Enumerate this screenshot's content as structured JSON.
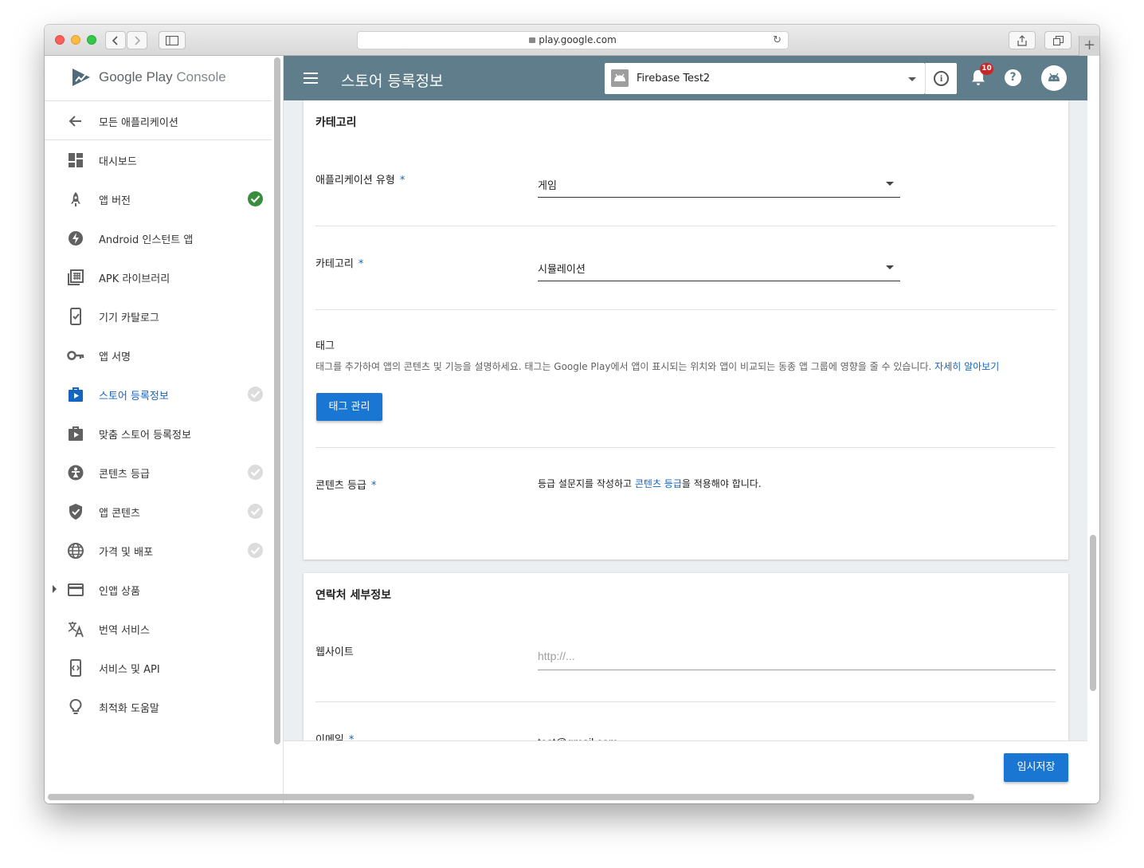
{
  "browser": {
    "url": "play.google.com"
  },
  "sidebar": {
    "brand_google": "Google Play",
    "brand_console": "Console",
    "back_label": "모든 애플리케이션",
    "items": [
      {
        "label": "대시보드",
        "icon": "dashboard-icon",
        "status": "none"
      },
      {
        "label": "앱 버전",
        "icon": "rocket-icon",
        "status": "complete"
      },
      {
        "label": "Android 인스턴트 앱",
        "icon": "instant-app-icon",
        "status": "none"
      },
      {
        "label": "APK 라이브러리",
        "icon": "library-icon",
        "status": "none"
      },
      {
        "label": "기기 카탈로그",
        "icon": "device-catalog-icon",
        "status": "none"
      },
      {
        "label": "앱 서명",
        "icon": "key-icon",
        "status": "none"
      },
      {
        "label": "스토어 등록정보",
        "icon": "store-listing-icon",
        "status": "pending",
        "active": true
      },
      {
        "label": "맞춤 스토어 등록정보",
        "icon": "custom-store-listing-icon",
        "status": "none"
      },
      {
        "label": "콘텐츠 등급",
        "icon": "content-rating-icon",
        "status": "pending"
      },
      {
        "label": "앱 콘텐츠",
        "icon": "shield-icon",
        "status": "pending"
      },
      {
        "label": "가격 및 배포",
        "icon": "globe-icon",
        "status": "pending"
      },
      {
        "label": "인앱 상품",
        "icon": "credit-card-icon",
        "status": "none"
      },
      {
        "label": "번역 서비스",
        "icon": "translate-icon",
        "status": "none"
      },
      {
        "label": "서비스 및 API",
        "icon": "api-icon",
        "status": "none"
      },
      {
        "label": "최적화 도움말",
        "icon": "lightbulb-icon",
        "status": "none"
      }
    ]
  },
  "appbar": {
    "title": "스토어 등록정보",
    "app_name": "Firebase Test2",
    "notification_count": "10",
    "help_symbol": "?",
    "info_symbol": "i"
  },
  "category_card": {
    "title": "카테고리",
    "app_type_label": "애플리케이션 유형",
    "app_type_value": "게임",
    "category_label": "카테고리",
    "category_value": "시뮬레이션",
    "required_mark": "*",
    "tags_title": "태그",
    "tags_desc": "태그를 추가하여 앱의 콘텐츠 및 기능을 설명하세요. 태그는 Google Play에서 앱이 표시되는 위치와 앱이 비교되는 동종 앱 그룹에 영향을 줄 수 있습니다.",
    "tags_learn_more": "자세히 알아보기",
    "manage_tags_button": "태그 관리",
    "content_rating_label": "콘텐츠 등급",
    "content_rating_pre": "등급 설문지를 작성하고 ",
    "content_rating_link": "콘텐츠 등급",
    "content_rating_post": "을 적용해야 합니다."
  },
  "contact_card": {
    "title": "연락처 세부정보",
    "website_label": "웹사이트",
    "website_placeholder": "http://...",
    "email_label": "이메일",
    "email_value": "test@gmail.com"
  },
  "footer": {
    "save_draft_button": "임시저장"
  },
  "colors": {
    "appbar": "#607d8b",
    "accent": "#1565c0",
    "primary_button": "#1976d2",
    "status_complete": "#388e3c",
    "status_pending": "#dcdcdc"
  }
}
